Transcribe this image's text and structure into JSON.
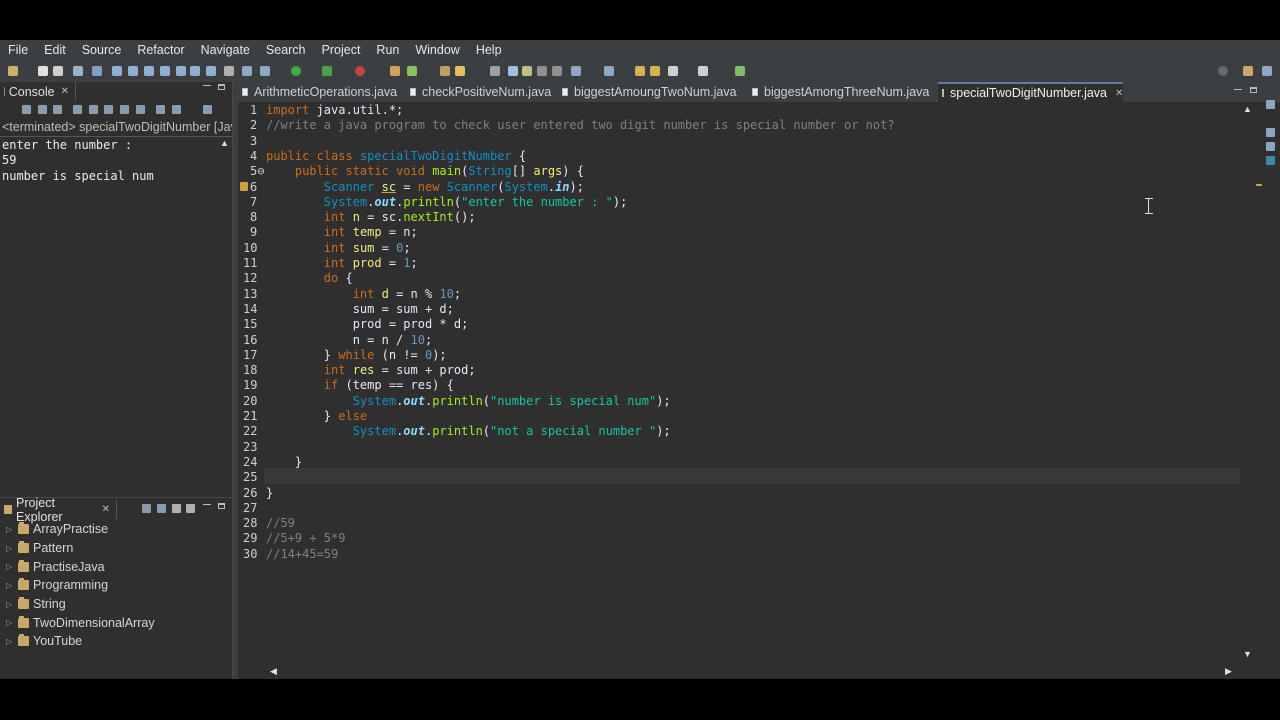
{
  "menu": [
    "File",
    "Edit",
    "Source",
    "Refactor",
    "Navigate",
    "Search",
    "Project",
    "Run",
    "Window",
    "Help"
  ],
  "console": {
    "tab_label": "Console",
    "status": "<terminated> specialTwoDigitNumber [Java",
    "output": "enter the number : \n59\nnumber is special num"
  },
  "explorer": {
    "tab_label": "Project Explorer",
    "projects": [
      "ArrayPractise",
      "Pattern",
      "PractiseJava",
      "Programming",
      "String",
      "TwoDimensionalArray",
      "YouTube"
    ]
  },
  "editor": {
    "tabs": [
      {
        "label": "ArithmeticOperations.java",
        "active": false
      },
      {
        "label": "checkPositiveNum.java",
        "active": false
      },
      {
        "label": "biggestAmoungTwoNum.java",
        "active": false
      },
      {
        "label": "biggestAmongThreeNum.java",
        "active": false
      },
      {
        "label": "specialTwoDigitNumber.java",
        "active": true
      }
    ],
    "line_numbers": [
      "1",
      "2",
      "3",
      "4",
      "5⊖",
      "6",
      "7",
      "8",
      "9",
      "10",
      "11",
      "12",
      "13",
      "14",
      "15",
      "16",
      "17",
      "18",
      "19",
      "20",
      "21",
      "22",
      "23",
      "24",
      "25",
      "26",
      "27",
      "28",
      "29",
      "30"
    ]
  },
  "colors": {
    "background": "#2f2f2f",
    "chrome": "#3b3f42",
    "keyword": "#cc6c1d",
    "string": "#17c6a3",
    "comment": "#808080",
    "number": "#6897bb"
  }
}
